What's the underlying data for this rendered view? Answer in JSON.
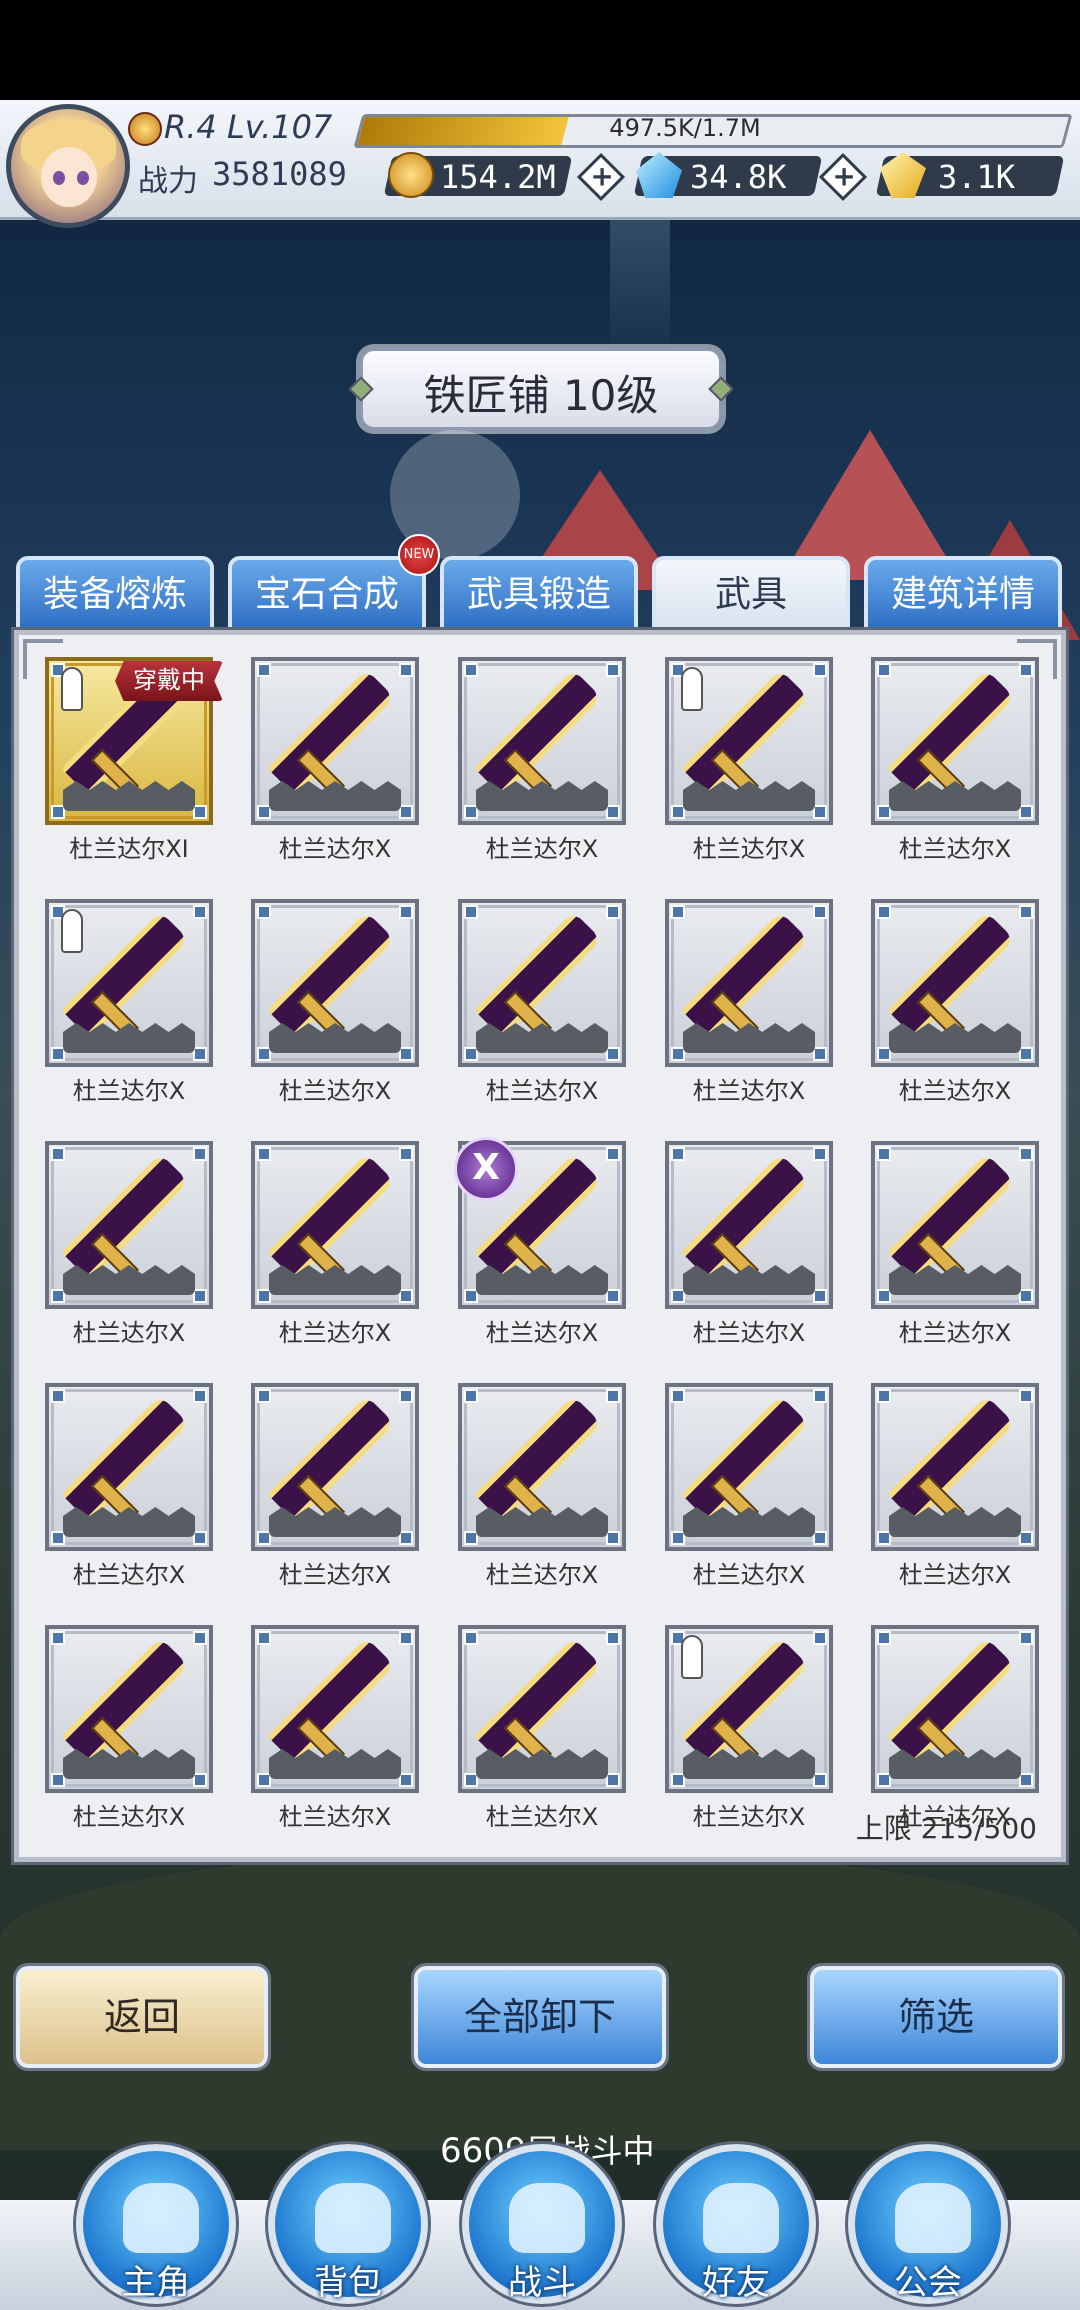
{
  "player": {
    "rank_level": "R.4 Lv.107",
    "xp_text": "497.5K/1.7M",
    "xp_fraction": 0.29,
    "power_label": "战力",
    "power_value": "3581089"
  },
  "currencies": [
    {
      "icon": "gold-coin-icon",
      "value": "154.2M"
    },
    {
      "icon": "blue-gem-icon",
      "value": "34.8K"
    },
    {
      "icon": "gold-gem-icon",
      "value": "3.1K"
    }
  ],
  "add_label": "+",
  "title": "铁匠铺 10级",
  "tabs": [
    {
      "label": "装备熔炼",
      "active": false
    },
    {
      "label": "宝石合成",
      "active": false,
      "badge": "NEW"
    },
    {
      "label": "武具锻造",
      "active": false
    },
    {
      "label": "武具",
      "active": true
    },
    {
      "label": "建筑详情",
      "active": false
    }
  ],
  "equipped_tag": "穿戴中",
  "gem_badge_symbol": "X",
  "items": [
    {
      "name": "杜兰达尔XI",
      "equipped": true,
      "locked": true
    },
    {
      "name": "杜兰达尔X"
    },
    {
      "name": "杜兰达尔X"
    },
    {
      "name": "杜兰达尔X",
      "locked": true
    },
    {
      "name": "杜兰达尔X"
    },
    {
      "name": "杜兰达尔X",
      "locked": true
    },
    {
      "name": "杜兰达尔X"
    },
    {
      "name": "杜兰达尔X"
    },
    {
      "name": "杜兰达尔X"
    },
    {
      "name": "杜兰达尔X"
    },
    {
      "name": "杜兰达尔X"
    },
    {
      "name": "杜兰达尔X"
    },
    {
      "name": "杜兰达尔X",
      "gem": true
    },
    {
      "name": "杜兰达尔X"
    },
    {
      "name": "杜兰达尔X"
    },
    {
      "name": "杜兰达尔X"
    },
    {
      "name": "杜兰达尔X"
    },
    {
      "name": "杜兰达尔X"
    },
    {
      "name": "杜兰达尔X"
    },
    {
      "name": "杜兰达尔X"
    },
    {
      "name": "杜兰达尔X"
    },
    {
      "name": "杜兰达尔X"
    },
    {
      "name": "杜兰达尔X"
    },
    {
      "name": "杜兰达尔X",
      "locked": true
    },
    {
      "name": "杜兰达尔X"
    }
  ],
  "limit": "上限 215/500",
  "buttons": {
    "back": "返回",
    "unequip_all": "全部卸下",
    "filter": "筛选"
  },
  "battle_status": {
    "floor": "6609",
    "text": "层战斗中"
  },
  "nav": [
    {
      "label": "主角",
      "icon": "hero-helmet-icon"
    },
    {
      "label": "背包",
      "icon": "backpack-icon"
    },
    {
      "label": "战斗",
      "icon": "crossed-swords-icon"
    },
    {
      "label": "好友",
      "icon": "handshake-icon"
    },
    {
      "label": "公会",
      "icon": "guild-crest-icon"
    }
  ]
}
